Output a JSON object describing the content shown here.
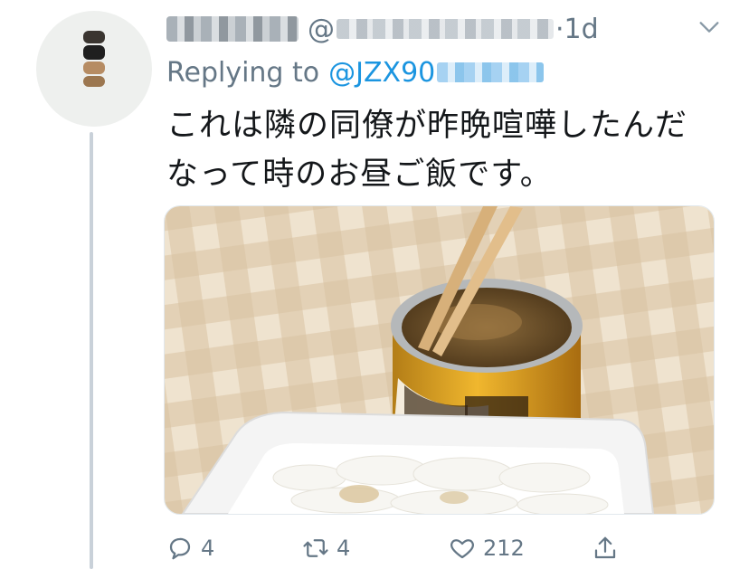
{
  "tweet": {
    "timestamp": "1d",
    "at_symbol": "@",
    "separator": "·",
    "replying_prefix": "Replying to",
    "replying_mention": "@JZX90",
    "text_lines": [
      "これは隣の同僚が昨晩喧嘩したんだ",
      "なって時のお昼ご飯です。"
    ]
  },
  "actions": {
    "reply_count": "4",
    "retweet_count": "4",
    "like_count": "212"
  },
  "icons": {
    "reply": "reply-icon",
    "retweet": "retweet-icon",
    "like": "heart-icon",
    "share": "share-icon",
    "menu": "chevron-down-icon"
  },
  "colors": {
    "secondary_text": "#657786",
    "link": "#1b95e0",
    "thread_line": "#c9d1d9"
  }
}
